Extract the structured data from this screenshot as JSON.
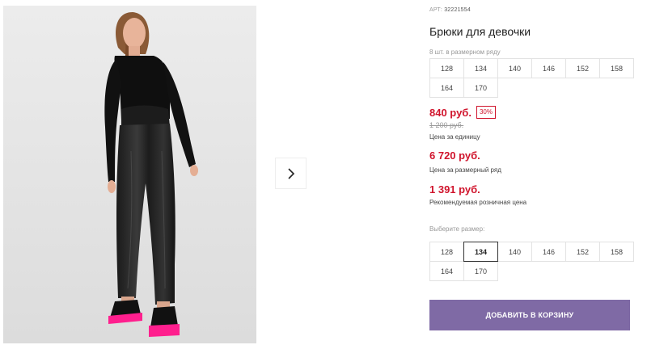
{
  "product": {
    "article_label": "АРТ:",
    "article_number": "32221554",
    "title": "Брюки для девочки",
    "pack_note": "8 шт. в размерном ряду"
  },
  "size_row": [
    "128",
    "134",
    "140",
    "146",
    "152",
    "158",
    "164",
    "170"
  ],
  "pricing": {
    "price": "840 руб.",
    "discount": "30%",
    "old_price": "1 200 руб.",
    "unit_caption": "Цена за единицу",
    "row_price": "6 720 руб.",
    "row_caption": "Цена за размерный ряд",
    "retail_price": "1 391 руб.",
    "retail_caption": "Рекомендуемая розничная цена"
  },
  "size_picker": {
    "label": "Выберите размер:",
    "options": [
      "128",
      "134",
      "140",
      "146",
      "152",
      "158",
      "164",
      "170"
    ],
    "selected": "134"
  },
  "cart": {
    "button_label": "ДОБАВИТЬ В КОРЗИНУ"
  },
  "icons": {
    "next": "chevron-right-icon"
  },
  "colors": {
    "accent": "#7f6aa5",
    "price": "#d0142c",
    "sole": "#ff1f8e"
  }
}
